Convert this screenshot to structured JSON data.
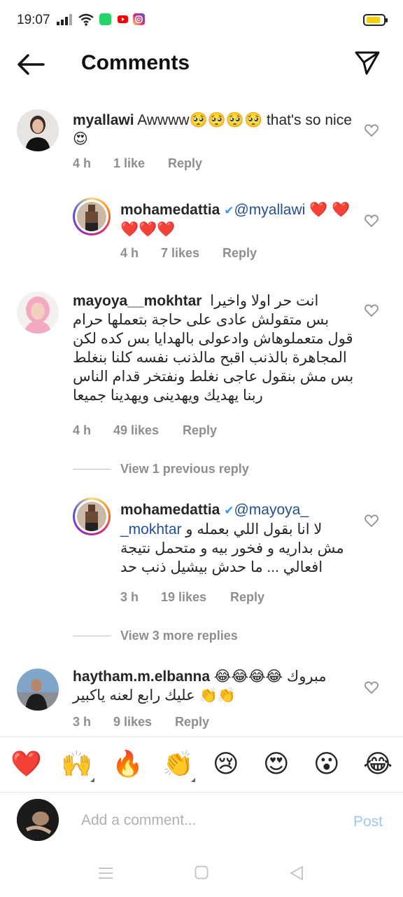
{
  "status": {
    "time": "19:07"
  },
  "header": {
    "title": "Comments"
  },
  "comments": [
    {
      "user": "myallawi",
      "text": "Awwww🥺🥺🥺🥺 that's so nice 😍",
      "time": "4 h",
      "likes": "1 like",
      "reply": "Reply"
    },
    {
      "user": "mohamedattia",
      "mention": "@myallawi",
      "text": "❤️ ❤️❤️❤️❤️",
      "time": "4 h",
      "likes": "7 likes",
      "reply": "Reply"
    },
    {
      "user": "mayoya__mokhtar",
      "text_lines": [
        "انت حر اولا واخيرا",
        "بس متقولش عادى على حاجة بتعملها حرام",
        "قول متعملوهاش وادعولى بالهدايا بس كده لكن",
        "المجاهرة بالذنب اقبح مالذنب نفسه كلنا بنغلط",
        "بس مش بنقول عاجى نغلط ونفتخر قدام الناس",
        "ربنا يهديك ويهدينى ويهدينا جميعا"
      ],
      "time": "4 h",
      "likes": "49 likes",
      "reply": "Reply"
    },
    {
      "user": "mohamedattia",
      "mention_line1": "@mayoya_",
      "mention_line2": "_mokhtar",
      "text_line2": "لا انا بقول اللي بعمله و",
      "text_lines": [
        "مش بداريه و فخور بيه و متحمل نتيجة",
        "افعالي ... ما حدش بيشيل ذنب حد"
      ],
      "time": "3 h",
      "likes": "19 likes",
      "reply": "Reply"
    },
    {
      "user": "haytham.m.elbanna",
      "text_line1": "😂😂😂😂 مبروك",
      "text_line2": "عليك رابع لعنه ياكبير 👏👏",
      "time": "3 h",
      "likes": "9 likes",
      "reply": "Reply"
    }
  ],
  "view_replies": {
    "previous": "View 1 previous reply",
    "more": "View 3 more replies"
  },
  "emoji_bar": [
    "❤️",
    "🙌",
    "🔥",
    "👏",
    "😢",
    "😍",
    "😮",
    "😂"
  ],
  "composer": {
    "placeholder": "Add a comment...",
    "post": "Post"
  },
  "colors": {
    "text": "#262626",
    "meta": "#8e8e8e",
    "mention": "#22508f",
    "post_disabled": "#9cc7f3"
  }
}
